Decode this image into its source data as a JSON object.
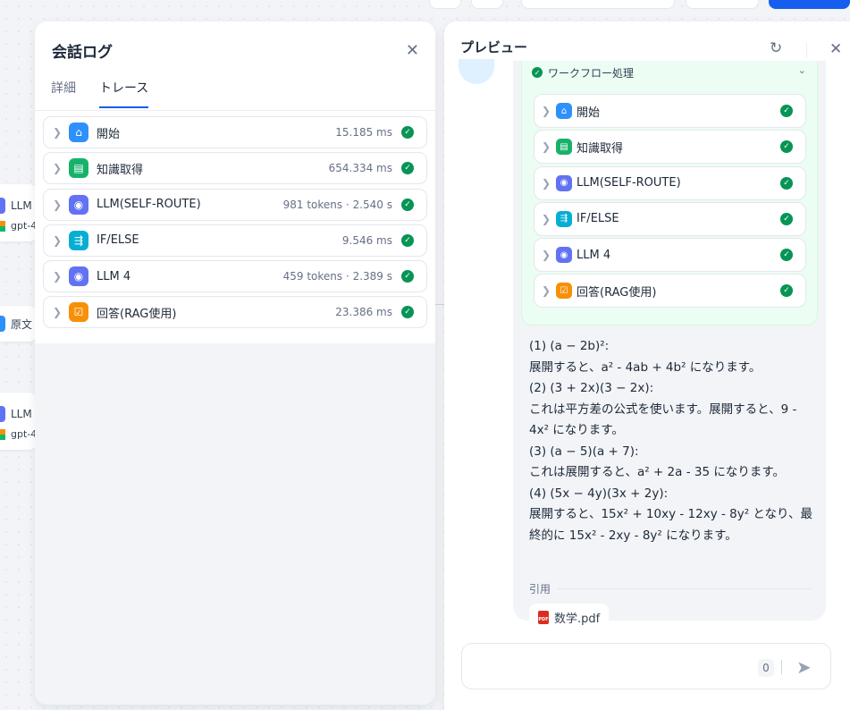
{
  "colors": {
    "accent": "#155eef",
    "success": "#079455",
    "icon_start": "#2e90fa",
    "icon_knowledge": "#17b26a",
    "icon_llm": "#6172f3",
    "icon_ifelse": "#06aed4",
    "icon_answer": "#f79009"
  },
  "canvas": {
    "nodes": [
      {
        "title": "LLM",
        "model": "gpt-4"
      },
      {
        "title": "原文"
      },
      {
        "title": "LLM",
        "model": "gpt-4"
      }
    ]
  },
  "log_panel": {
    "title": "会話ログ",
    "close_icon": "close-icon",
    "tabs": [
      {
        "label": "詳細",
        "active": false
      },
      {
        "label": "トレース",
        "active": true
      }
    ],
    "trace": [
      {
        "name": "開始",
        "meta": "15.185 ms",
        "icon": "home-icon",
        "status": "success"
      },
      {
        "name": "知識取得",
        "meta": "654.334 ms",
        "icon": "book-icon",
        "status": "success"
      },
      {
        "name": "LLM(SELF-ROUTE)",
        "meta": "981 tokens · 2.540 s",
        "icon": "brain-icon",
        "status": "success"
      },
      {
        "name": "IF/ELSE",
        "meta": "9.546 ms",
        "icon": "branch-icon",
        "status": "success"
      },
      {
        "name": "LLM 4",
        "meta": "459 tokens · 2.389 s",
        "icon": "brain-icon",
        "status": "success"
      },
      {
        "name": "回答(RAG使用)",
        "meta": "23.386 ms",
        "icon": "answer-icon",
        "status": "success"
      }
    ]
  },
  "preview": {
    "title": "プレビュー",
    "workflow_header": "ワークフロー処理",
    "workflow_steps": [
      {
        "name": "開始",
        "icon": "home-icon"
      },
      {
        "name": "知識取得",
        "icon": "book-icon"
      },
      {
        "name": "LLM(SELF-ROUTE)",
        "icon": "brain-icon"
      },
      {
        "name": "IF/ELSE",
        "icon": "branch-icon"
      },
      {
        "name": "LLM 4",
        "icon": "brain-icon"
      },
      {
        "name": "回答(RAG使用)",
        "icon": "answer-icon"
      }
    ],
    "answer_lines": [
      "(1) (a − 2b)²:",
      "展開すると、a² - 4ab + 4b² になります。",
      "(2) (3 + 2x)(3 − 2x):",
      "これは平方差の公式を使います。展開すると、9 - 4x² になります。",
      "(3) (a − 5)(a + 7):",
      "これは展開すると、a² + 2a - 35 になります。",
      "(4) (5x − 4y)(3x + 2y):",
      "展開すると、15x² + 10xy - 12xy - 8y² となり、最終的に 15x² - 2xy - 8y² になります。"
    ],
    "citation_label": "引用",
    "citation_file": "数学.pdf",
    "input": {
      "value": "",
      "char_count": "0"
    }
  }
}
